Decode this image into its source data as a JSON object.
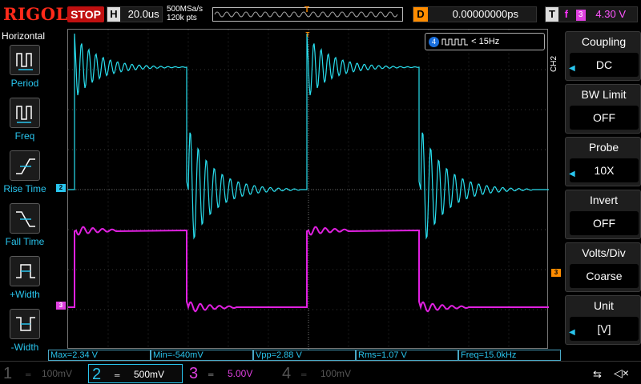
{
  "topbar": {
    "logo": "RIGOL",
    "run_status": "STOP",
    "horizontal_label": "H",
    "timebase": "20.0us",
    "sample_rate": "500MSa/s",
    "memory_depth": "120k pts",
    "trigger_pos_marker": "T",
    "delay_label": "D",
    "delay_value": "0.00000000ps",
    "trigger_label": "T",
    "trigger_edge": "f",
    "trigger_source": "3",
    "trigger_level": "4.30 V"
  },
  "leftmenu": {
    "title": "Horizontal",
    "items": [
      {
        "label": "Period",
        "icon": "period-icon"
      },
      {
        "label": "Freq",
        "icon": "freq-icon"
      },
      {
        "label": "Rise Time",
        "icon": "rise-time-icon"
      },
      {
        "label": "Fall Time",
        "icon": "fall-time-icon"
      },
      {
        "label": "+Width",
        "icon": "pos-width-icon"
      },
      {
        "label": "-Width",
        "icon": "neg-width-icon"
      }
    ]
  },
  "grid": {
    "trigger_marker": "T",
    "ch2_marker": "2",
    "ch3_marker": "3",
    "trigger_level_marker": "3",
    "counter": {
      "channel": "4",
      "text": "< 15Hz"
    }
  },
  "rightmenu": {
    "channel_tag": "CH2",
    "items": [
      {
        "title": "Coupling",
        "value": "DC",
        "has_arrow": true
      },
      {
        "title": "BW Limit",
        "value": "OFF",
        "has_arrow": false
      },
      {
        "title": "Probe",
        "value": "10X",
        "has_arrow": true
      },
      {
        "title": "Invert",
        "value": "OFF",
        "has_arrow": false
      },
      {
        "title": "Volts/Div",
        "value": "Coarse",
        "has_arrow": false
      },
      {
        "title": "Unit",
        "value": "[V]",
        "has_arrow": true
      }
    ]
  },
  "measurements": [
    {
      "label": "Max=2.34 V"
    },
    {
      "label": "Min=-540mV"
    },
    {
      "label": "Vpp=2.88 V"
    },
    {
      "label": "Rms=1.07 V"
    },
    {
      "label": "Freq=15.0kHz"
    }
  ],
  "channels": [
    {
      "num": "1",
      "scale": "100mV",
      "color": "#555555"
    },
    {
      "num": "2",
      "scale": "500mV",
      "color": "#29c5ee"
    },
    {
      "num": "3",
      "scale": "5.00V",
      "color": "#e040e0"
    },
    {
      "num": "4",
      "scale": "100mV",
      "color": "#555555"
    }
  ],
  "colors": {
    "ch2": "#29e0f0",
    "ch3": "#e020e0",
    "trigger": "#ff8c00",
    "accent": "#29c5ee"
  }
}
